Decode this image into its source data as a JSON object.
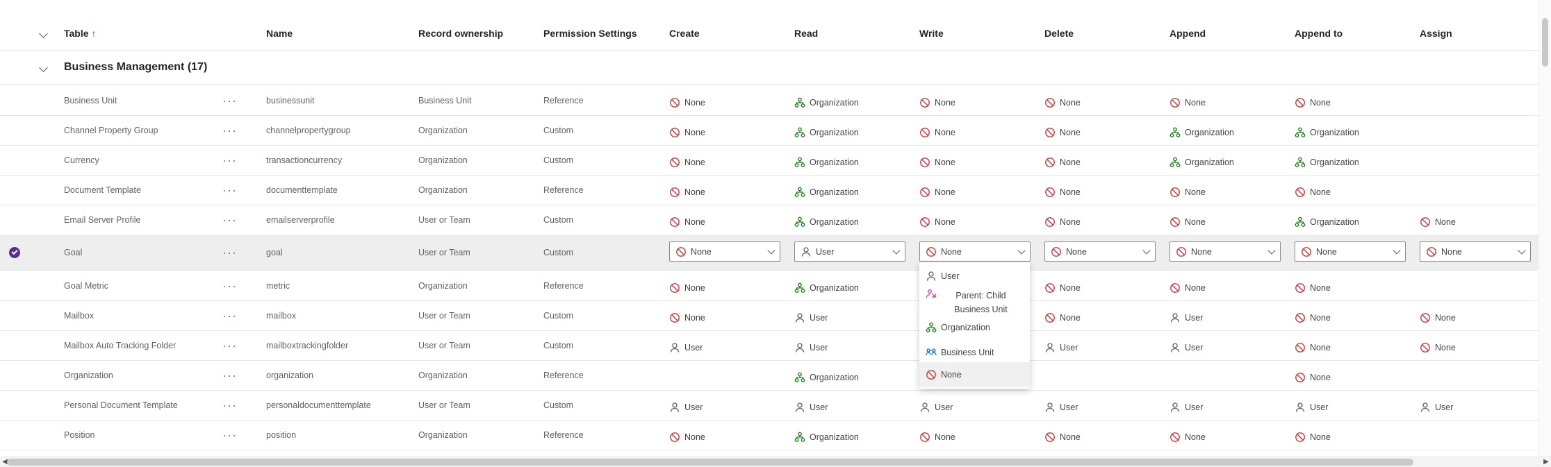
{
  "header": {
    "table": "Table",
    "sort_indicator": "↑",
    "name": "Name",
    "record_ownership": "Record ownership",
    "permission_settings": "Permission Settings",
    "create": "Create",
    "read": "Read",
    "write": "Write",
    "delete": "Delete",
    "append": "Append",
    "append_to": "Append to",
    "assign": "Assign"
  },
  "section": {
    "title": "Business Management (17)"
  },
  "rows": [
    {
      "table": "Business Unit",
      "name": "businessunit",
      "ownership": "Business Unit",
      "settings": "Reference",
      "create": "None",
      "read": "Organization",
      "write": "None",
      "delete": "None",
      "append": "None",
      "append_to": "None",
      "assign": ""
    },
    {
      "table": "Channel Property Group",
      "name": "channelpropertygroup",
      "ownership": "Organization",
      "settings": "Custom",
      "create": "None",
      "read": "Organization",
      "write": "None",
      "delete": "None",
      "append": "Organization",
      "append_to": "Organization",
      "assign": ""
    },
    {
      "table": "Currency",
      "name": "transactioncurrency",
      "ownership": "Organization",
      "settings": "Custom",
      "create": "None",
      "read": "Organization",
      "write": "None",
      "delete": "None",
      "append": "Organization",
      "append_to": "Organization",
      "assign": ""
    },
    {
      "table": "Document Template",
      "name": "documenttemplate",
      "ownership": "Organization",
      "settings": "Reference",
      "create": "None",
      "read": "Organization",
      "write": "None",
      "delete": "None",
      "append": "None",
      "append_to": "None",
      "assign": ""
    },
    {
      "table": "Email Server Profile",
      "name": "emailserverprofile",
      "ownership": "User or Team",
      "settings": "Custom",
      "create": "None",
      "read": "Organization",
      "write": "None",
      "delete": "None",
      "append": "None",
      "append_to": "Organization",
      "assign": "None"
    },
    {
      "table": "Goal",
      "name": "goal",
      "ownership": "User or Team",
      "settings": "Custom",
      "create": "None",
      "read": "User",
      "write": "None",
      "delete": "None",
      "append": "None",
      "append_to": "None",
      "assign": "None"
    },
    {
      "table": "Goal Metric",
      "name": "metric",
      "ownership": "Organization",
      "settings": "Reference",
      "create": "None",
      "read": "Organization",
      "write": "",
      "delete": "None",
      "append": "None",
      "append_to": "None",
      "assign": ""
    },
    {
      "table": "Mailbox",
      "name": "mailbox",
      "ownership": "User or Team",
      "settings": "Custom",
      "create": "None",
      "read": "User",
      "write": "",
      "delete": "None",
      "append": "User",
      "append_to": "None",
      "assign": "None"
    },
    {
      "table": "Mailbox Auto Tracking Folder",
      "name": "mailboxtrackingfolder",
      "ownership": "User or Team",
      "settings": "Custom",
      "create": "User",
      "read": "User",
      "write": "",
      "delete": "User",
      "append": "User",
      "append_to": "None",
      "assign": "None"
    },
    {
      "table": "Organization",
      "name": "organization",
      "ownership": "Organization",
      "settings": "Reference",
      "create": "",
      "read": "Organization",
      "write": "",
      "delete": "",
      "append": "",
      "append_to": "None",
      "assign": ""
    },
    {
      "table": "Personal Document Template",
      "name": "personaldocumenttemplate",
      "ownership": "User or Team",
      "settings": "Custom",
      "create": "User",
      "read": "User",
      "write": "User",
      "delete": "User",
      "append": "User",
      "append_to": "User",
      "assign": "User"
    },
    {
      "table": "Position",
      "name": "position",
      "ownership": "Organization",
      "settings": "Reference",
      "create": "None",
      "read": "Organization",
      "write": "None",
      "delete": "None",
      "append": "None",
      "append_to": "None",
      "assign": ""
    }
  ],
  "dropdown_menu": {
    "options": [
      {
        "icon": "user",
        "label": "User"
      },
      {
        "icon": "parent-child",
        "label": "Parent: Child Business Unit"
      },
      {
        "icon": "organization",
        "label": "Organization"
      },
      {
        "icon": "business-unit",
        "label": "Business Unit"
      },
      {
        "icon": "none",
        "label": "None",
        "selected": true
      }
    ]
  },
  "colors": {
    "none": "#d13438",
    "organization": "#107c10",
    "user": "#605e5c",
    "accent": "#5c2d91",
    "selected_row": "#eeeeee"
  }
}
